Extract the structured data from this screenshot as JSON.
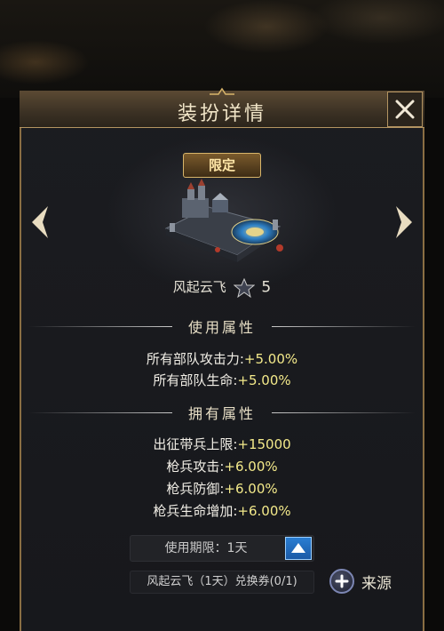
{
  "dialog": {
    "title": "装扮详情",
    "close_icon": "close-x-icon"
  },
  "skin": {
    "badge": "限定",
    "name": "风起云飞",
    "level": "5",
    "star_icon": "star-badge-icon",
    "image": "fortress-skin-image"
  },
  "nav": {
    "prev_icon": "chevron-left-icon",
    "next_icon": "chevron-right-icon"
  },
  "use_attributes": {
    "heading": "使用属性",
    "items": [
      {
        "label": "所有部队攻击力:",
        "value": "+5.00%"
      },
      {
        "label": "所有部队生命:",
        "value": "+5.00%"
      }
    ]
  },
  "own_attributes": {
    "heading": "拥有属性",
    "items": [
      {
        "label": "出征带兵上限:",
        "value": "+15000"
      },
      {
        "label": "枪兵攻击:",
        "value": "+6.00%"
      },
      {
        "label": "枪兵防御:",
        "value": "+6.00%"
      },
      {
        "label": "枪兵生命增加:",
        "value": "+6.00%"
      }
    ]
  },
  "duration": {
    "text": "使用期限：1天",
    "toggle_icon": "triangle-up-icon"
  },
  "voucher": {
    "text": "风起云飞（1天）兑换券(0/1)"
  },
  "source": {
    "label": "来源",
    "icon": "plus-circle-icon"
  },
  "colors": {
    "frame_gold": "#8a6e43",
    "value_yellow": "#f3e98a",
    "button_blue": "#2a7ed3",
    "panel_bg": "#1b1c20"
  }
}
